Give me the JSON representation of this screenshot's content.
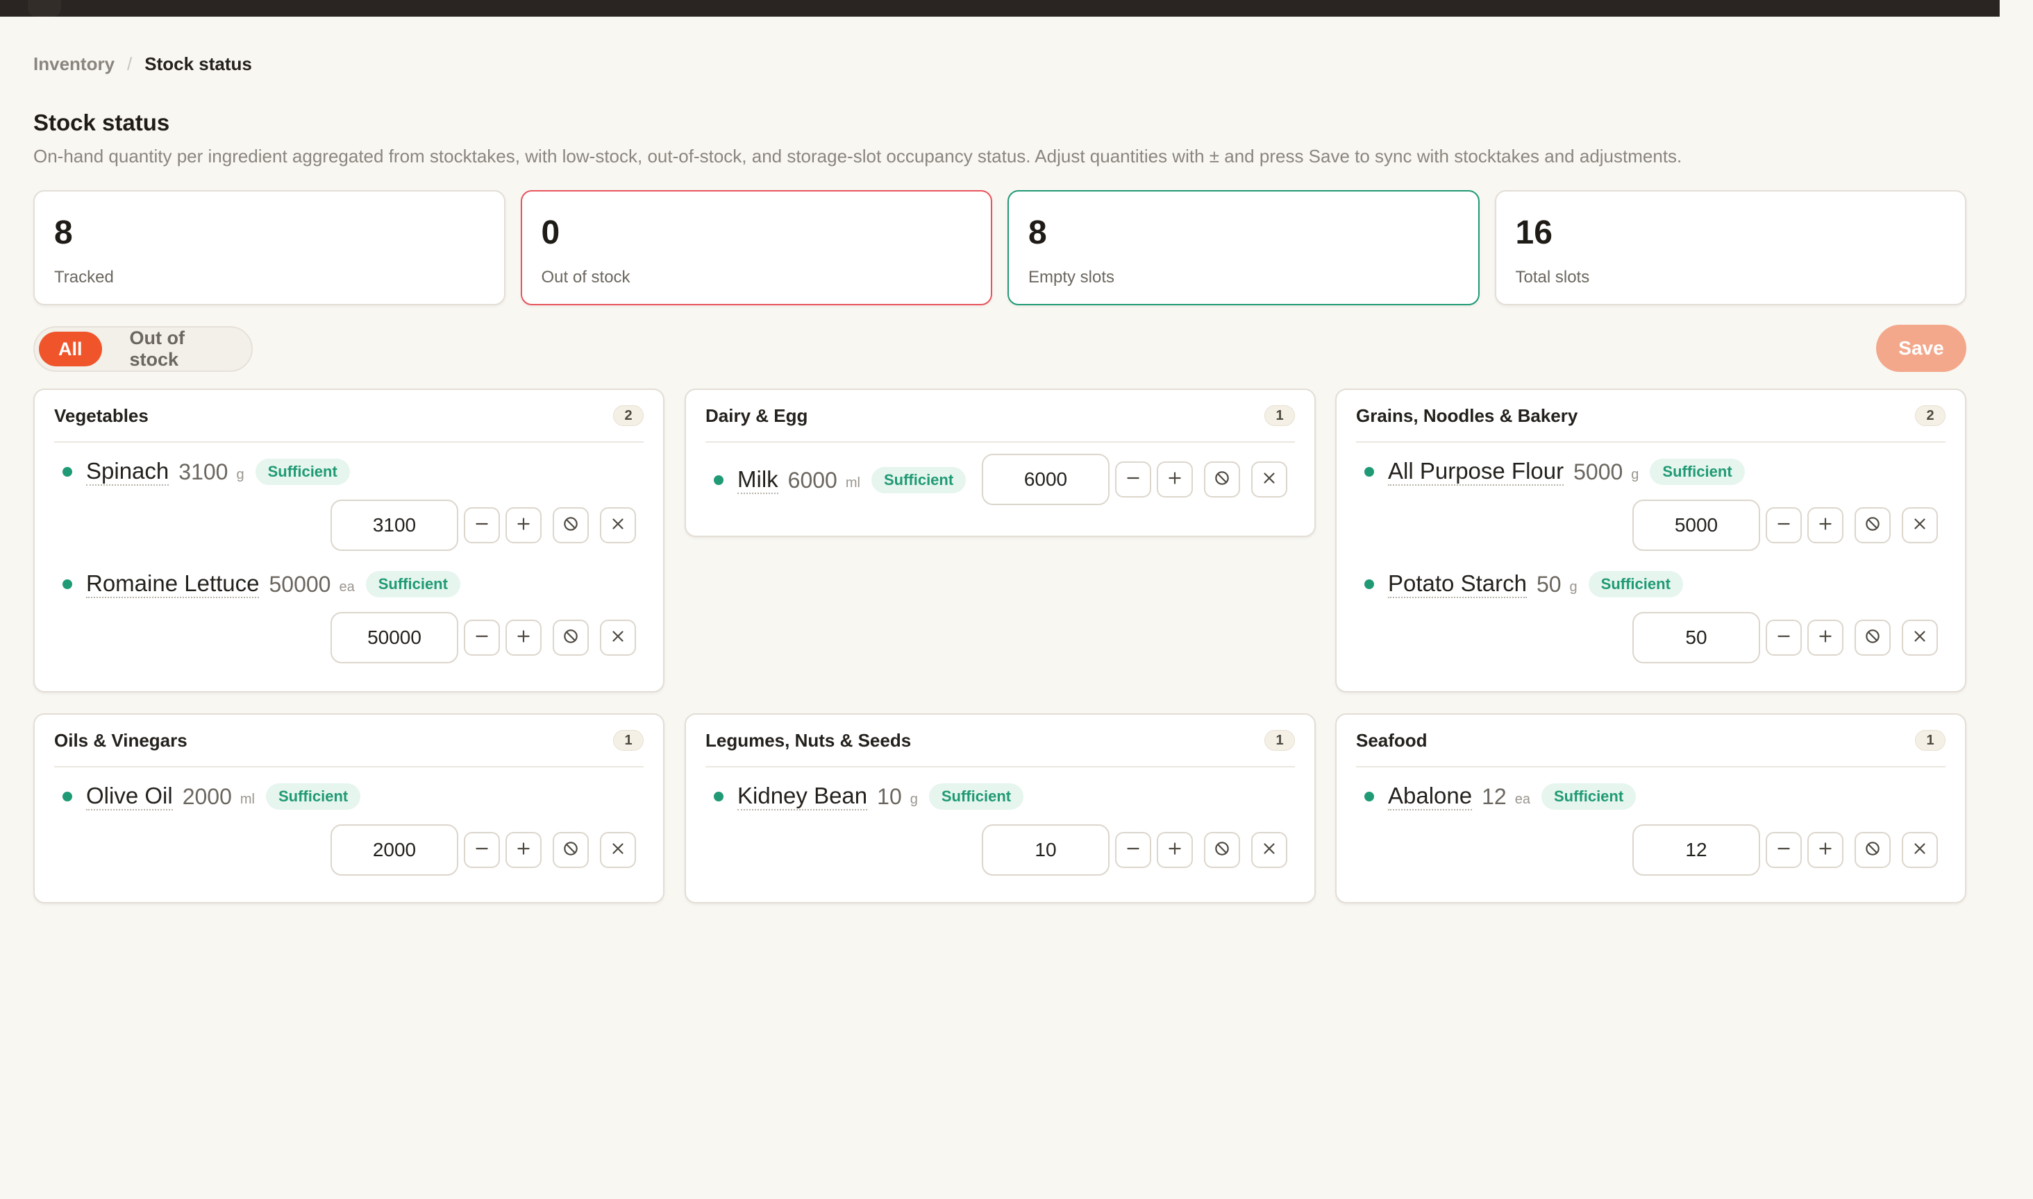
{
  "breadcrumb": {
    "parent": "Inventory",
    "separator": "/",
    "current": "Stock status"
  },
  "header": {
    "title": "Stock status",
    "description": "On-hand quantity per ingredient aggregated from stocktakes, with low-stock, out-of-stock, and storage-slot occupancy status. Adjust quantities with ± and press Save to sync with stocktakes and adjustments."
  },
  "stats": [
    {
      "value": "8",
      "label": "Tracked"
    },
    {
      "value": "0",
      "label": "Out of stock"
    },
    {
      "value": "8",
      "label": "Empty slots"
    },
    {
      "value": "16",
      "label": "Total slots"
    }
  ],
  "filters": {
    "all": "All",
    "out_of_stock": "Out of stock",
    "selected": "All"
  },
  "save_label": "Save",
  "colors": {
    "accent": "#f0542a",
    "save_disabled": "#f3a88c",
    "sufficient": "#1f9a74",
    "danger": "#e8545c"
  },
  "icons": {
    "decrement": "minus-icon",
    "increment": "plus-icon",
    "clear": "ban-icon",
    "remove": "close-icon",
    "status": "status-dot-icon"
  },
  "categories": [
    {
      "title": "Vegetables",
      "count": "2",
      "items": [
        {
          "name": "Spinach",
          "qty": "3100",
          "unit": "g",
          "status": "Sufficient",
          "input": "3100"
        },
        {
          "name": "Romaine Lettuce",
          "qty": "50000",
          "unit": "ea",
          "status": "Sufficient",
          "input": "50000"
        }
      ]
    },
    {
      "title": "Dairy & Egg",
      "count": "1",
      "items": [
        {
          "name": "Milk",
          "qty": "6000",
          "unit": "ml",
          "status": "Sufficient",
          "input": "6000"
        }
      ]
    },
    {
      "title": "Grains, Noodles & Bakery",
      "count": "2",
      "items": [
        {
          "name": "All Purpose Flour",
          "qty": "5000",
          "unit": "g",
          "status": "Sufficient",
          "input": "5000"
        },
        {
          "name": "Potato Starch",
          "qty": "50",
          "unit": "g",
          "status": "Sufficient",
          "input": "50"
        }
      ]
    },
    {
      "title": "Oils & Vinegars",
      "count": "1",
      "items": [
        {
          "name": "Olive Oil",
          "qty": "2000",
          "unit": "ml",
          "status": "Sufficient",
          "input": "2000"
        }
      ]
    },
    {
      "title": "Legumes, Nuts & Seeds",
      "count": "1",
      "items": [
        {
          "name": "Kidney Bean",
          "qty": "10",
          "unit": "g",
          "status": "Sufficient",
          "input": "10"
        }
      ]
    },
    {
      "title": "Seafood",
      "count": "1",
      "items": [
        {
          "name": "Abalone",
          "qty": "12",
          "unit": "ea",
          "status": "Sufficient",
          "input": "12"
        }
      ]
    }
  ]
}
